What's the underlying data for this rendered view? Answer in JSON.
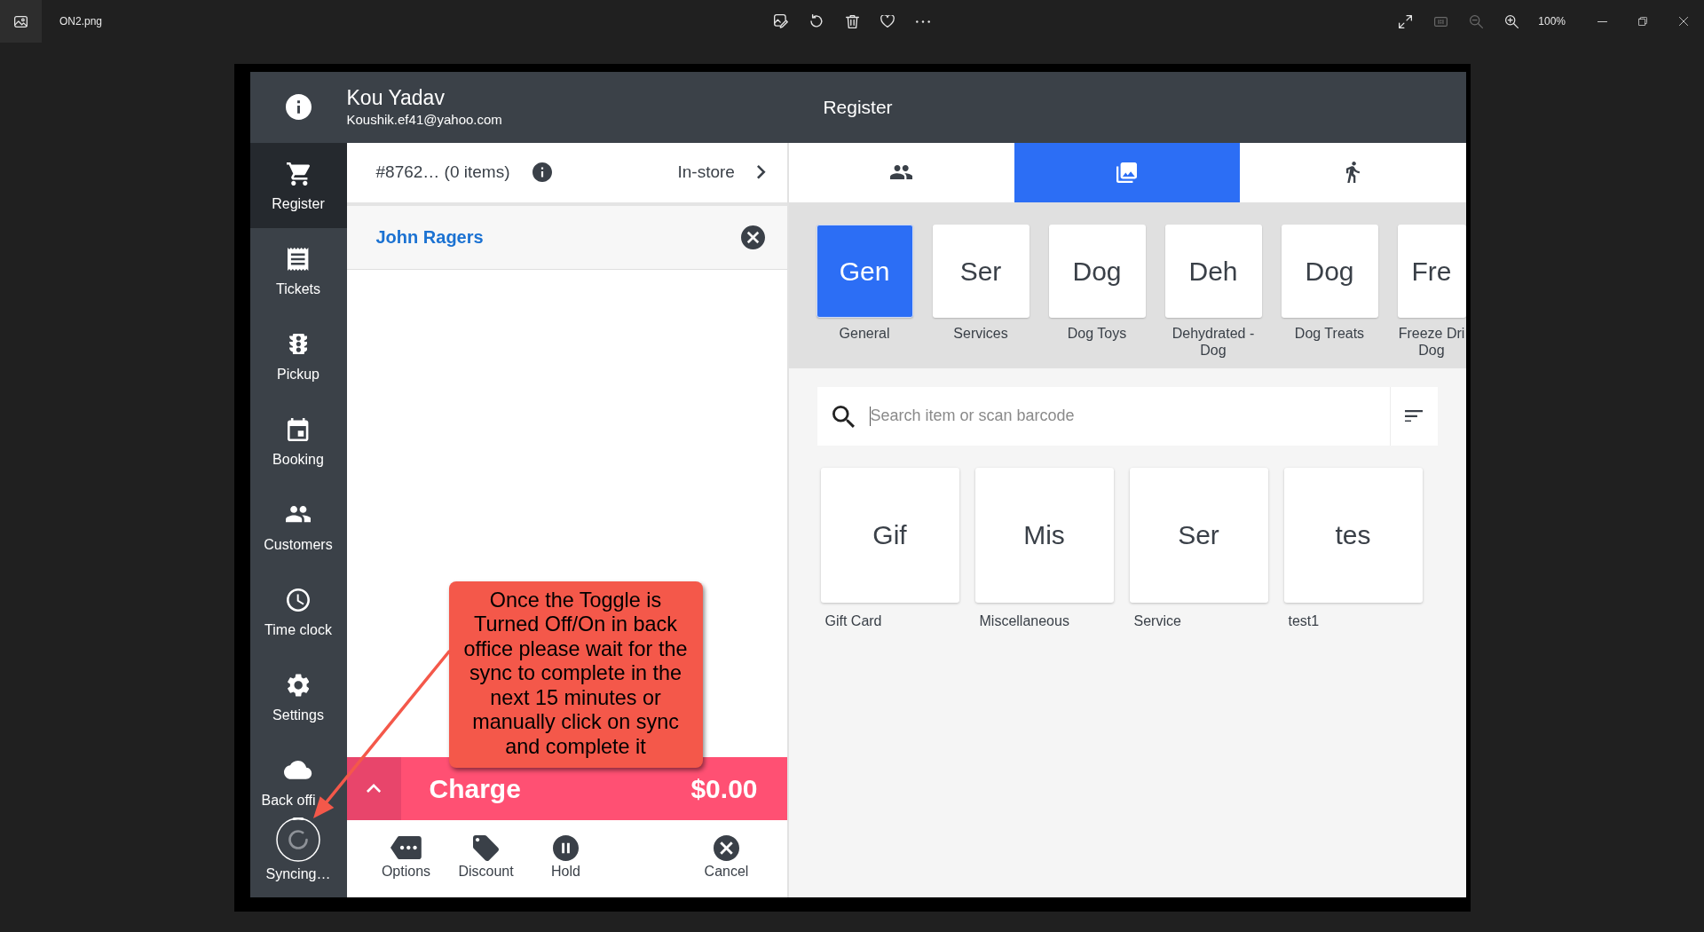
{
  "viewer": {
    "file_name": "ON2.png",
    "tools": [
      {
        "kind": "edit",
        "disabled": false
      },
      {
        "kind": "rotate",
        "disabled": false
      },
      {
        "kind": "delete",
        "disabled": false
      },
      {
        "kind": "favorite",
        "disabled": false
      },
      {
        "kind": "more",
        "disabled": false
      }
    ],
    "view_tools": [
      {
        "kind": "fit",
        "disabled": false
      },
      {
        "kind": "actual_size",
        "disabled": true
      },
      {
        "kind": "zoom_out",
        "disabled": true
      },
      {
        "kind": "zoom_in",
        "disabled": false
      }
    ],
    "zoom": "100%"
  },
  "app": {
    "header": {
      "user_name": "Kou Yadav",
      "user_email": "Koushik.ef41@yahoo.com",
      "title": "Register"
    },
    "sidebar": {
      "items": [
        {
          "kind": "register",
          "label": "Register",
          "selected": true
        },
        {
          "kind": "tickets",
          "label": "Tickets",
          "selected": false
        },
        {
          "kind": "pickup",
          "label": "Pickup",
          "selected": false
        },
        {
          "kind": "booking",
          "label": "Booking",
          "selected": false
        },
        {
          "kind": "customers",
          "label": "Customers",
          "selected": false
        },
        {
          "kind": "time_clock",
          "label": "Time clock",
          "selected": false
        },
        {
          "kind": "settings",
          "label": "Settings",
          "selected": false
        },
        {
          "kind": "back_office",
          "label": "Back offi",
          "selected": false
        }
      ],
      "sync": {
        "label": "Syncing…"
      }
    },
    "order": {
      "ticket": "#8762… (0 items)",
      "type": "In-store",
      "customer": "John Ragers",
      "charge": {
        "label": "Charge",
        "amount": "$0.00"
      },
      "actions": [
        {
          "kind": "options",
          "label": "Options"
        },
        {
          "kind": "discount",
          "label": "Discount"
        },
        {
          "kind": "hold",
          "label": "Hold"
        },
        {
          "kind": "cancel",
          "label": "Cancel"
        }
      ]
    },
    "catalog": {
      "tabs": [
        {
          "kind": "customers",
          "selected": false
        },
        {
          "kind": "library",
          "selected": true
        },
        {
          "kind": "walk_in",
          "selected": false
        }
      ],
      "categories": [
        {
          "abbr": "Gen",
          "label": "General",
          "selected": true
        },
        {
          "abbr": "Ser",
          "label": "Services",
          "selected": false
        },
        {
          "abbr": "Dog",
          "label": "Dog Toys",
          "selected": false
        },
        {
          "abbr": "Deh",
          "label": "Dehydrated - Dog",
          "selected": false
        },
        {
          "abbr": "Dog",
          "label": "Dog Treats",
          "selected": false
        },
        {
          "abbr": "Fre",
          "label": "Freeze Dri\nDog",
          "selected": false
        }
      ],
      "search": {
        "placeholder": "Search item or scan barcode"
      },
      "items": [
        {
          "abbr": "Gif",
          "label": "Gift Card"
        },
        {
          "abbr": "Mis",
          "label": "Miscellaneous"
        },
        {
          "abbr": "Ser",
          "label": "Service"
        },
        {
          "abbr": "tes",
          "label": "test1"
        }
      ]
    }
  },
  "annotation": {
    "text": "Once the Toggle is Turned Off/On in back office please wait for the sync to complete in the next 15 minutes or manually click on sync and complete it"
  }
}
